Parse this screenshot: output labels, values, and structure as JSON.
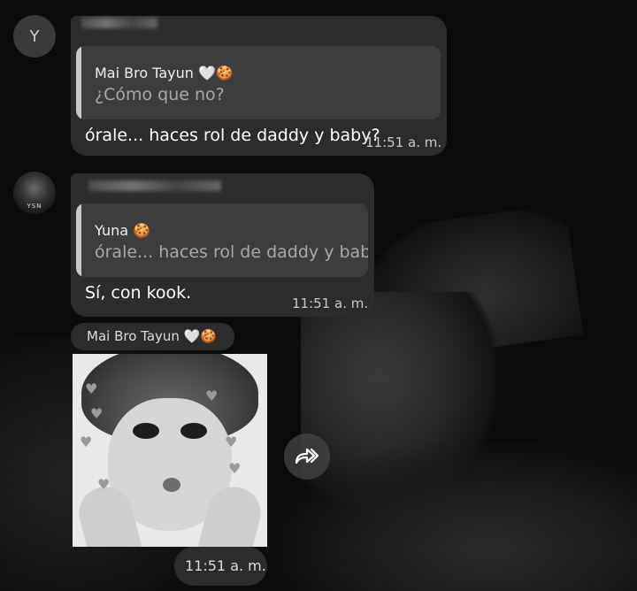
{
  "messages": [
    {
      "avatar_initial": "Y",
      "reply_to_name": "Mai Bro Tayun 🤍🍪",
      "reply_to_text": "¿Cómo que no?",
      "text": "órale... haces rol de daddy y baby?",
      "time": "11:51 a. m."
    },
    {
      "avatar_tag": "YSN",
      "reply_to_name": "Yuna 🍪",
      "reply_to_text": "órale... haces rol de daddy y baby?",
      "text": "Sí, con kook.",
      "time": "11:51 a. m."
    }
  ],
  "image_message": {
    "sender_name": "Mai Bro Tayun 🤍🍪",
    "time": "11:51 a. m.",
    "forward_icon": "forward-arrow-icon"
  }
}
